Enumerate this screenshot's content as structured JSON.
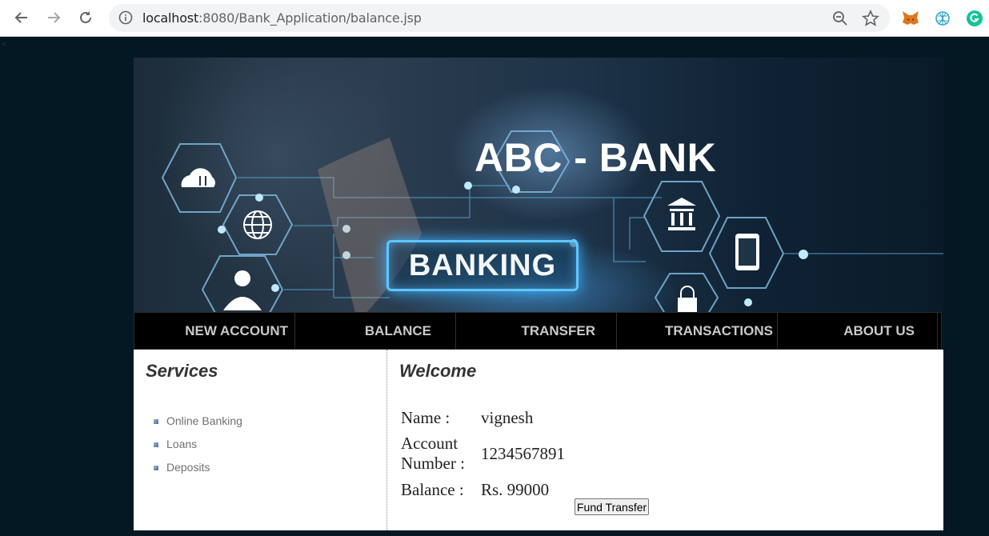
{
  "browser": {
    "url_host": "localhost",
    "url_path": ":8080/Bank_Application/balance.jsp",
    "icons": [
      "back-icon",
      "forward-icon",
      "reload-icon",
      "info-icon",
      "zoom-icon",
      "star-icon",
      "metamask-icon",
      "extension-icon",
      "grammarly-icon"
    ]
  },
  "banner": {
    "title": "ABC - BANK",
    "sign_text": "BANKING"
  },
  "menu": {
    "items": [
      "NEW ACCOUNT",
      "BALANCE",
      "TRANSFER",
      "TRANSACTIONS",
      "ABOUT US"
    ]
  },
  "sidebar": {
    "heading": "Services",
    "items": [
      "Online Banking",
      "Loans",
      "Deposits"
    ]
  },
  "main": {
    "heading": "Welcome",
    "name_label": "Name :",
    "name_value": "vignesh",
    "account_label_1": "Account",
    "account_label_2": "Number :",
    "account_value": "1234567891",
    "balance_label": "Balance :",
    "balance_value": "Rs. 99000",
    "fund_transfer_button": "Fund Transfer"
  },
  "colors": {
    "page_background": "#041823",
    "menu_background": "#000000",
    "menu_text": "#c9c9c9",
    "glow": "#5fc6ff"
  }
}
